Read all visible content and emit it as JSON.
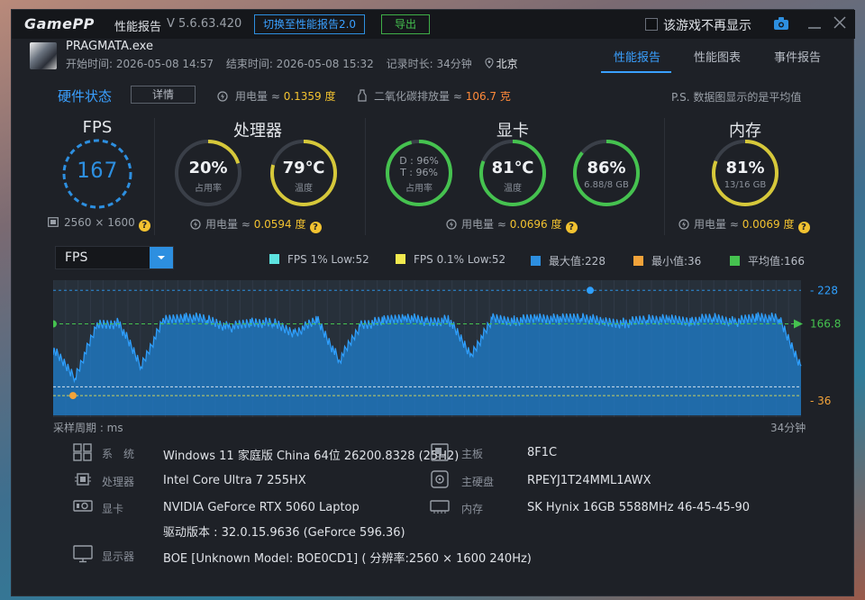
{
  "titlebar": {
    "logo": "GamePP",
    "title": "性能报告",
    "version": "V 5.6.63.420",
    "switch_label": "切换至性能报告2.0",
    "export_label": "导出",
    "dont_show_label": "该游戏不再显示"
  },
  "header": {
    "game": "PRAGMATA.exe",
    "start": "开始时间: 2026-05-08 14:57",
    "end": "结束时间: 2026-05-08 15:32",
    "duration": "记录时长: 34分钟",
    "location": "北京",
    "tabs": [
      {
        "label": "性能报告",
        "active": true
      },
      {
        "label": "性能图表",
        "active": false
      },
      {
        "label": "事件报告",
        "active": false
      }
    ]
  },
  "hardware": {
    "title": "硬件状态",
    "detail_label": "详情",
    "power_prefix": "用电量 ≈ ",
    "power_value": "0.1359 度",
    "co2_prefix": "二氧化碳排放量 ≈ ",
    "co2_value": "106.7 克",
    "note": "P.S. 数据图显示的是平均值"
  },
  "sections": {
    "fps": {
      "title": "FPS",
      "value": "167",
      "resolution": "2560 × 1600"
    },
    "cpu": {
      "title": "处理器",
      "usage": {
        "value": "20%",
        "label": "占用率",
        "fraction": 0.2
      },
      "temp": {
        "value": "79℃",
        "label": "温度",
        "fraction": 0.79
      },
      "power_prefix": "用电量 ≈ ",
      "power_value": "0.0594 度"
    },
    "gpu": {
      "title": "显卡",
      "usage": {
        "d": "D : 96%",
        "t": "T : 96%",
        "label": "占用率",
        "fraction": 0.96
      },
      "temp": {
        "value": "81℃",
        "label": "温度",
        "fraction": 0.81
      },
      "vram": {
        "value": "86%",
        "label": "6.88/8 GB",
        "fraction": 0.86
      },
      "power_prefix": "用电量 ≈ ",
      "power_value": "0.0696 度"
    },
    "mem": {
      "title": "内存",
      "usage": {
        "value": "81%",
        "label": "13/16 GB",
        "fraction": 0.81
      },
      "power_prefix": "用电量 ≈ ",
      "power_value": "0.0069 度"
    }
  },
  "chart_controls": {
    "selected": "FPS",
    "legend": [
      {
        "label": "FPS 1% Low:52",
        "color": "#5de3e0"
      },
      {
        "label": "FPS 0.1% Low:52",
        "color": "#f2e94e"
      },
      {
        "label": "最大值:228",
        "color": "#2d8fe0"
      },
      {
        "label": "最小值:36",
        "color": "#f2a33a"
      },
      {
        "label": "平均值:166",
        "color": "#45c24f"
      }
    ],
    "x_left_label": "采样周期 : ms",
    "x_right_label": "34分钟"
  },
  "chart_data": {
    "type": "area",
    "ylim": [
      0,
      240
    ],
    "max": 228,
    "min": 36,
    "avg": 166.8,
    "low1": 52,
    "max_label": "228",
    "min_label": "36",
    "avg_label": "166.8",
    "x": [
      0,
      1,
      2,
      3,
      4,
      5,
      6,
      7,
      8,
      9,
      10,
      11,
      12,
      13,
      14,
      15,
      16,
      17,
      18,
      19,
      20,
      21,
      22,
      23,
      24,
      25,
      26,
      27,
      28,
      29,
      30,
      31,
      32,
      33,
      34
    ],
    "values": [
      120,
      70,
      165,
      168,
      90,
      172,
      180,
      175,
      160,
      170,
      168,
      150,
      175,
      100,
      165,
      172,
      180,
      170,
      174,
      110,
      176,
      172,
      178,
      175,
      180,
      170,
      168,
      176,
      174,
      172,
      178,
      170,
      180,
      176,
      90
    ]
  },
  "sysinfo": [
    {
      "key": "系　统",
      "value": "Windows 11 家庭版 China 64位 26200.8328 (25H2)",
      "icon": "windows-icon"
    },
    {
      "key": "主板",
      "value": "8F1C",
      "icon": "motherboard-icon"
    },
    {
      "key": "处理器",
      "value": "Intel Core Ultra 7 255HX",
      "icon": "cpu-icon"
    },
    {
      "key": "主硬盘",
      "value": "RPEYJ1T24MML1AWX",
      "icon": "disk-icon"
    },
    {
      "key": "显卡",
      "value": "NVIDIA GeForce RTX 5060 Laptop",
      "icon": "gpu-icon"
    },
    {
      "key": "内存",
      "value": "SK Hynix 16GB 5588MHz 46-45-45-90",
      "icon": "memory-icon"
    },
    {
      "key": "驱动版本",
      "value": "驱动版本 : 32.0.15.9636 (GeForce 596.36)",
      "icon": ""
    },
    {
      "key": "显示器",
      "value": "BOE [Unknown Model: BOE0CD1] ( 分辨率:2560 × 1600 240Hz)",
      "icon": "monitor-icon"
    }
  ]
}
